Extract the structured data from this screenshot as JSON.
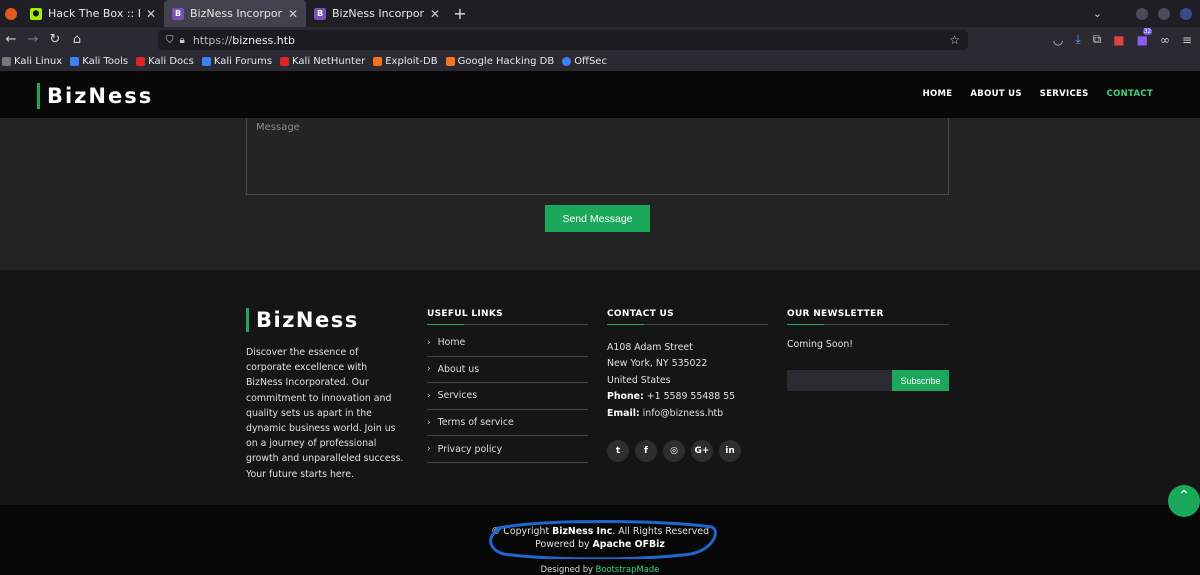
{
  "browser": {
    "tabs": [
      {
        "title": "Hack The Box :: Hack The",
        "favicon": "htb-icon",
        "active": false
      },
      {
        "title": "BizNess Incorporated",
        "favicon": "bootstrap-icon",
        "active": true
      },
      {
        "title": "BizNess Incorporated",
        "favicon": "bootstrap-icon",
        "active": false
      }
    ],
    "url_protocol": "https://",
    "url_host": "bizness.htb",
    "extension_badge": "32",
    "bookmarks": [
      {
        "label": "Kali Linux",
        "color": "#3b82f6"
      },
      {
        "label": "Kali Tools",
        "color": "#3b82f6"
      },
      {
        "label": "Kali Docs",
        "color": "#dc2626"
      },
      {
        "label": "Kali Forums",
        "color": "#3b82f6"
      },
      {
        "label": "Kali NetHunter",
        "color": "#dc2626"
      },
      {
        "label": "Exploit-DB",
        "color": "#f97316"
      },
      {
        "label": "Google Hacking DB",
        "color": "#f97316"
      },
      {
        "label": "OffSec",
        "color": "#3b82f6"
      }
    ]
  },
  "site": {
    "brand": "BizNess",
    "menu": [
      "HOME",
      "ABOUT US",
      "SERVICES",
      "CONTACT"
    ],
    "active_menu": "CONTACT",
    "message_placeholder": "Message",
    "send_label": "Send Message",
    "accent": "#1aa95a"
  },
  "footer": {
    "brand": "BizNess",
    "about": "Discover the essence of corporate excellence with BizNess Incorporated. Our commitment to innovation and quality sets us apart in the dynamic business world. Join us on a journey of professional growth and unparalleled success. Your future starts here.",
    "links_title": "USEFUL LINKS",
    "links": [
      "Home",
      "About us",
      "Services",
      "Terms of service",
      "Privacy policy"
    ],
    "contact_title": "CONTACT US",
    "address1": "A108 Adam Street",
    "address2": "New York, NY 535022",
    "address3": "United States",
    "phone_label": "Phone:",
    "phone": "+1 5589 55488 55",
    "email_label": "Email:",
    "email": "info@bizness.htb",
    "socials": [
      {
        "icon": "twitter-icon",
        "glyph": "t"
      },
      {
        "icon": "facebook-icon",
        "glyph": "f"
      },
      {
        "icon": "instagram-icon",
        "glyph": "◎"
      },
      {
        "icon": "google-plus-icon",
        "glyph": "G+"
      },
      {
        "icon": "linkedin-icon",
        "glyph": "in"
      }
    ],
    "newsletter_title": "OUR NEWSLETTER",
    "newsletter_text": "Coming Soon!",
    "subscribe_label": "Subscribe",
    "copyright_prefix": "© Copyright ",
    "copyright_company": "BizNess Inc",
    "copyright_suffix": ". All Rights Reserved",
    "powered_prefix": "Powered by ",
    "powered_by": "Apache OFBiz",
    "designed_prefix": "Designed by ",
    "designed_by": "BootstrapMade"
  }
}
